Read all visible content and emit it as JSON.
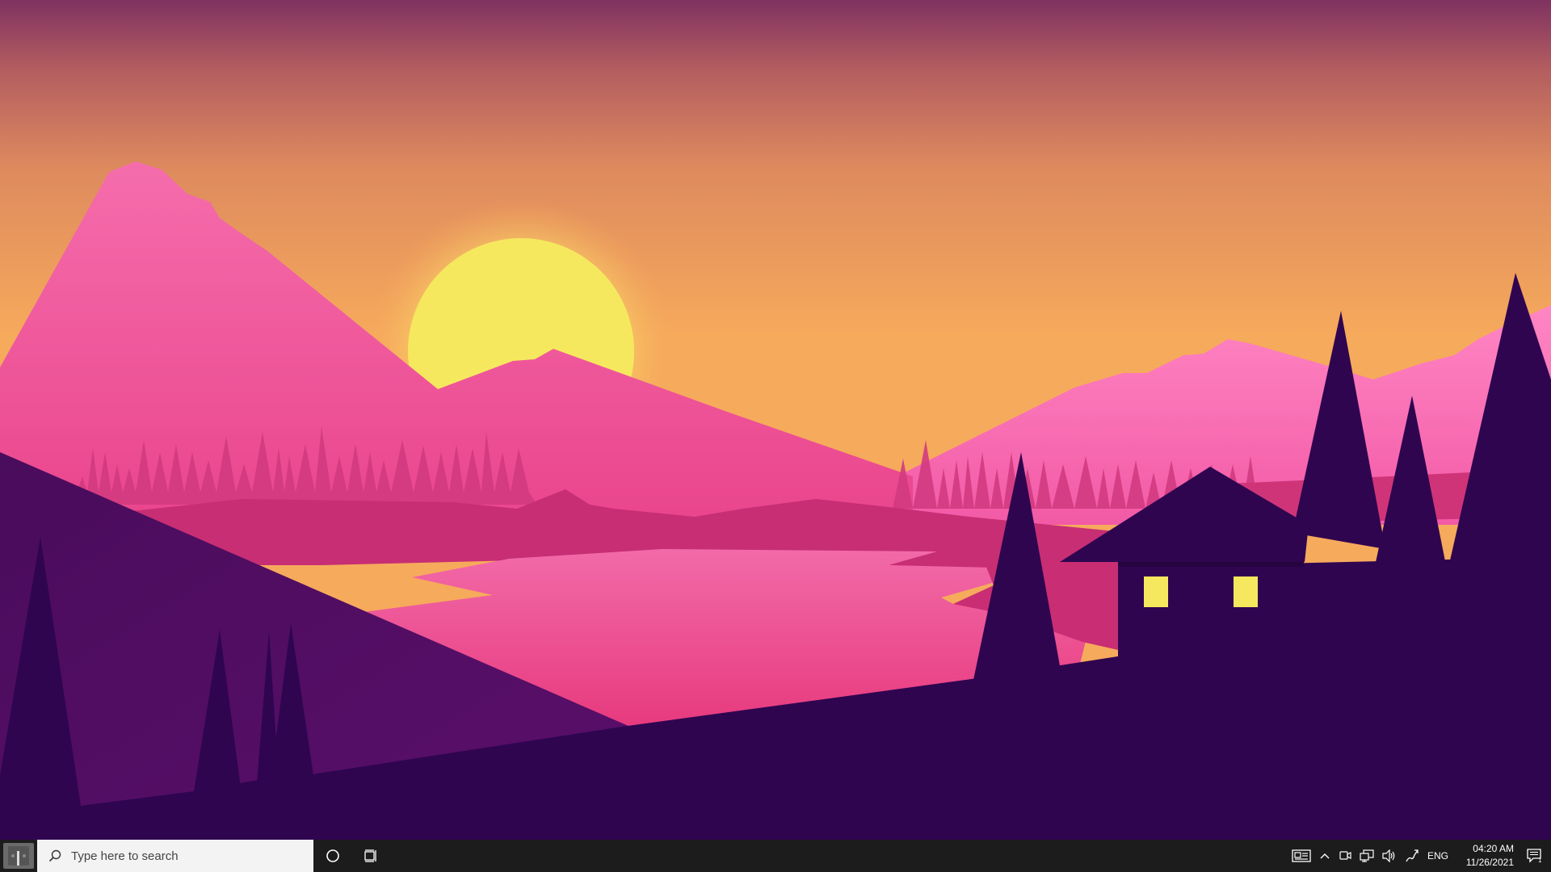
{
  "desktop": {
    "wallpaper_icon": "sunset-mountain-landscape-wallpaper",
    "colors": {
      "sky_top": "#7f3260",
      "sky_mid": "#d68060",
      "sky_low": "#f6aa5c",
      "sun": "#f6e85e",
      "mountain_left": "#f370ac",
      "mountain_mid": "#ec4f8c",
      "mountain_right": "#ff78bc",
      "lake": "#f15a9a",
      "hill_purple": "#570e65",
      "foreground": "#2f0550",
      "window_light": "#f6e85e"
    }
  },
  "taskbar": {
    "background": "#1c1c1c",
    "start_icon": "windows-start-icon",
    "search": {
      "placeholder": "Type here to search",
      "icon": "search-icon"
    },
    "cortana_icon": "cortana-circle-icon",
    "task_view_icon": "task-view-icon",
    "tray": {
      "news_icon": "news-and-interests-icon",
      "chevron_icon": "show-hidden-icons-chevron",
      "meet_icon": "meet-now-icon",
      "network_icon": "network-icon",
      "volume_icon": "volume-icon",
      "pen_icon": "pen-workspace-icon",
      "language": "ENG",
      "time": "04:20 AM",
      "date": "11/26/2021",
      "notifications_icon": "action-center-icon",
      "notification_count": "1"
    }
  }
}
